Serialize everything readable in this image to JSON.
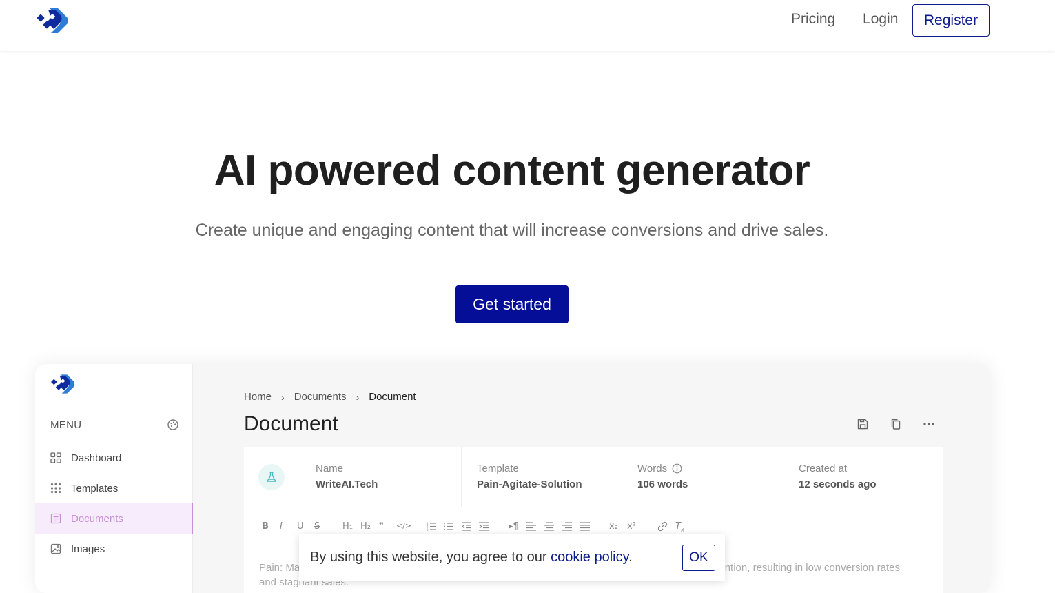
{
  "nav": {
    "logo": "logo-icon",
    "pricing": "Pricing",
    "login": "Login",
    "register": "Register"
  },
  "hero": {
    "title": "AI powered content generator",
    "subtitle": "Create unique and engaging content that will increase conversions and drive sales.",
    "cta": "Get started"
  },
  "preview": {
    "menu_label": "MENU",
    "sidebar": {
      "items": [
        {
          "label": "Dashboard",
          "icon": "grid-icon"
        },
        {
          "label": "Templates",
          "icon": "dots-grid-icon"
        },
        {
          "label": "Documents",
          "icon": "document-icon",
          "active": true
        },
        {
          "label": "Images",
          "icon": "image-icon"
        }
      ]
    },
    "breadcrumb": [
      "Home",
      "Documents",
      "Document"
    ],
    "doc_title": "Document",
    "info": {
      "name_label": "Name",
      "name_value": "WriteAI.Tech",
      "template_label": "Template",
      "template_value": "Pain-Agitate-Solution",
      "words_label": "Words",
      "words_value": "106 words",
      "created_label": "Created at",
      "created_value": "12 seconds ago"
    },
    "toolbar": [
      "B",
      "I",
      "U",
      "S",
      "H₁",
      "H₂",
      "99",
      "</>",
      "ol",
      "ul",
      "outdent",
      "indent",
      "¶",
      "left",
      "center",
      "right",
      "justify",
      "x₂",
      "x²",
      "link",
      "clear"
    ],
    "editor_line1_start": "Pain: Ma",
    "editor_line1_end": "tention, resulting in low conversion rates",
    "editor_line2": "and stagnant sales."
  },
  "cookie": {
    "text": "By using this website, you agree to our ",
    "link": "cookie policy",
    "period": ".",
    "ok": "OK"
  },
  "colors": {
    "brand": "#050e96",
    "accent_purple": "#c88ed8",
    "text": "#1f1f1f"
  }
}
